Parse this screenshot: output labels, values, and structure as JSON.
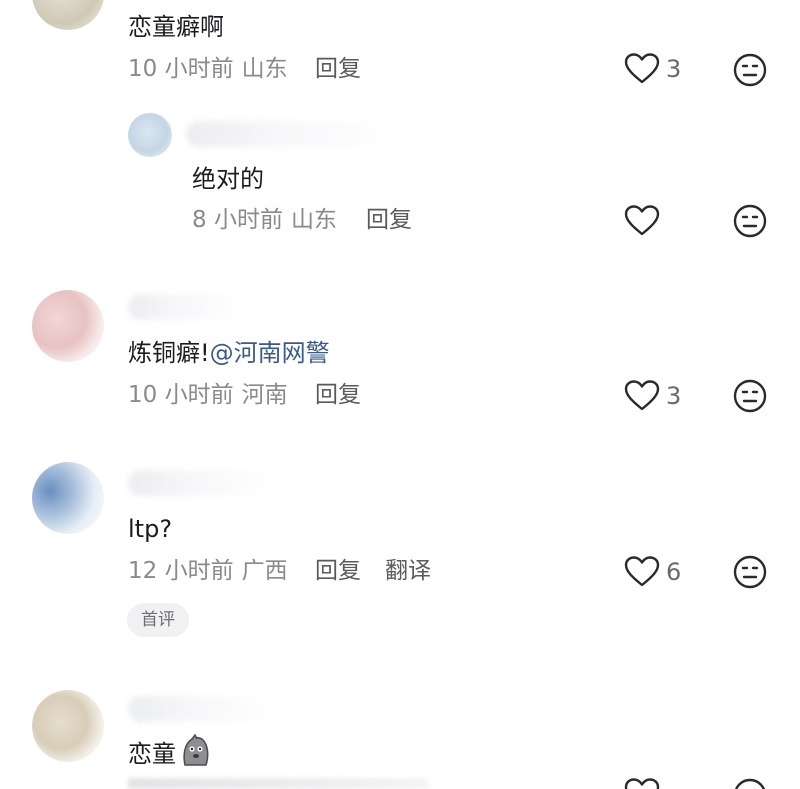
{
  "comments": [
    {
      "content": "恋童癖啊",
      "time": "10 小时前",
      "location": "山东",
      "reply_label": "回复",
      "likes": "3"
    },
    {
      "content": "绝对的",
      "time": "8 小时前",
      "location": "山东",
      "reply_label": "回复"
    },
    {
      "content_prefix": "炼铜癖!",
      "mention": "@河南网警",
      "time": "10 小时前",
      "location": "河南",
      "reply_label": "回复",
      "likes": "3"
    },
    {
      "content": "ltp?",
      "time": "12 小时前",
      "location": "广西",
      "reply_label": "回复",
      "translate_label": "翻译",
      "likes": "6",
      "tag": "首评"
    },
    {
      "content": "恋童",
      "emoji": "ghost-emoji"
    }
  ],
  "icons": {
    "like": "heart-outline-icon",
    "dislike": "neutral-face-icon"
  },
  "colors": {
    "meta_text": "#8a8a8e",
    "mention": "#3a5a8a",
    "icon_stroke": "#2a2a2e"
  }
}
